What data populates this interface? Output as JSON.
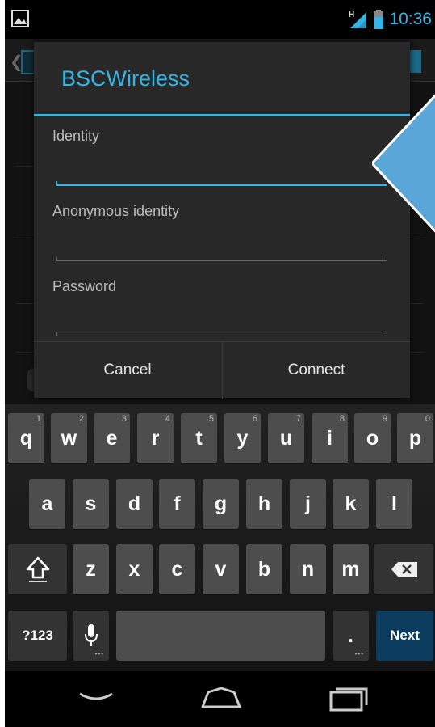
{
  "status_bar": {
    "time": "10:36",
    "network_type": "H",
    "icons": [
      "image-notification-icon",
      "signal-icon",
      "battery-icon"
    ]
  },
  "dialog": {
    "title": "BSCWireless",
    "fields": [
      {
        "label": "Identity",
        "value": "",
        "focused": true
      },
      {
        "label": "Anonymous identity",
        "value": "",
        "focused": false
      },
      {
        "label": "Password",
        "value": "",
        "focused": false
      }
    ],
    "buttons": {
      "cancel": "Cancel",
      "connect": "Connect"
    }
  },
  "keyboard": {
    "row1": [
      {
        "label": "q",
        "hint": "1"
      },
      {
        "label": "w",
        "hint": "2"
      },
      {
        "label": "e",
        "hint": "3"
      },
      {
        "label": "r",
        "hint": "4"
      },
      {
        "label": "t",
        "hint": "5"
      },
      {
        "label": "y",
        "hint": "6"
      },
      {
        "label": "u",
        "hint": "7"
      },
      {
        "label": "i",
        "hint": "8"
      },
      {
        "label": "o",
        "hint": "9"
      },
      {
        "label": "p",
        "hint": "0"
      }
    ],
    "row2": [
      "a",
      "s",
      "d",
      "f",
      "g",
      "h",
      "j",
      "k",
      "l"
    ],
    "row3": [
      "z",
      "x",
      "c",
      "v",
      "b",
      "n",
      "m"
    ],
    "symbols_label": "?123",
    "period_label": ".",
    "action_label": "Next"
  },
  "colors": {
    "accent": "#33b5e5",
    "action_key": "#0b3c5d"
  }
}
